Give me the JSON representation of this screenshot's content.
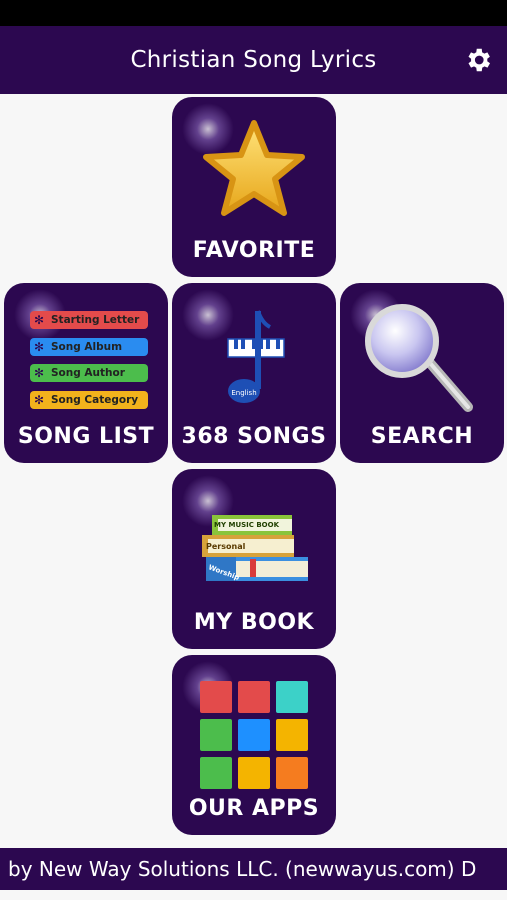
{
  "app": {
    "title": "Christian Song Lyrics"
  },
  "header": {
    "settings_icon": "gear-icon"
  },
  "tiles": {
    "favorite": {
      "label": "FAVORITE",
      "icon": "star-icon"
    },
    "song_list": {
      "label": "SONG LIST",
      "items": [
        "Starting Letter",
        "Song Album",
        "Song Author",
        "Song Category"
      ]
    },
    "songs": {
      "label": "368 SONGS",
      "icon": "music-note-icon",
      "badge": "English"
    },
    "search": {
      "label": "SEARCH",
      "icon": "magnifier-icon"
    },
    "my_book": {
      "label": "MY BOOK",
      "icon": "books-icon",
      "book_titles": [
        "MY MUSIC BOOK",
        "Personal",
        "Worship"
      ]
    },
    "our_apps": {
      "label": "OUR APPS",
      "icon": "apps-grid-icon"
    }
  },
  "colors": {
    "brand": "#2c0850",
    "app_squares": [
      "#e34b4b",
      "#e34b4b",
      "#3cd1c8",
      "#4cbd4c",
      "#1e90ff",
      "#f4b400",
      "#4cbd4c",
      "#f4b400",
      "#f57c1f"
    ]
  },
  "footer": {
    "text": "by New Way Solutions LLC. (newwayus.com)   D"
  }
}
